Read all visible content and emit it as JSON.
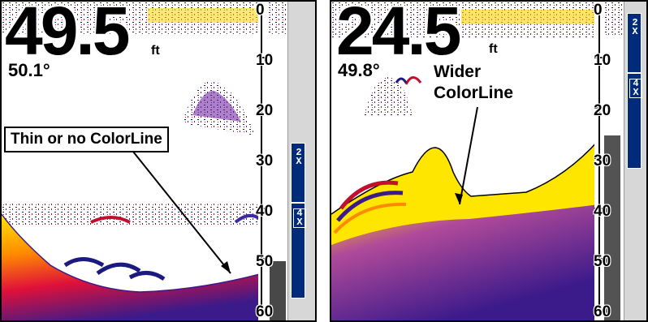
{
  "left_panel": {
    "depth_value": "49.5",
    "depth_unit": "ft",
    "temperature": "50.1°",
    "callout": "Thin or no ColorLine",
    "scale_labels": [
      "0",
      "10",
      "20",
      "30",
      "40",
      "50",
      "60"
    ],
    "zoom_labels": [
      "2 X",
      "4 X"
    ]
  },
  "right_panel": {
    "depth_value": "24.5",
    "depth_unit": "ft",
    "temperature": "49.8°",
    "callout_line1": "Wider",
    "callout_line2": "ColorLine",
    "scale_labels": [
      "0",
      "10",
      "20",
      "30",
      "40",
      "50",
      "60"
    ],
    "zoom_labels": [
      "2 X",
      "4 X"
    ]
  },
  "colors": {
    "bottom_yellow": "#ffe600",
    "bottom_orange": "#ff8a00",
    "bottom_red": "#e0103a",
    "bottom_purple": "#3b1a8a",
    "noise_navy": "#1a1a80",
    "zoom_blue": "#002a7a"
  }
}
